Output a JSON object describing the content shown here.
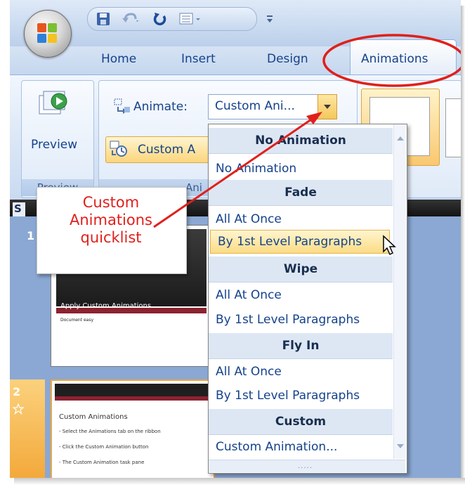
{
  "tabs": [
    {
      "label": "Home"
    },
    {
      "label": "Insert"
    },
    {
      "label": "Design"
    },
    {
      "label": "Animations"
    }
  ],
  "ribbon": {
    "preview_button_label": "Preview",
    "preview_group_label": "Preview",
    "animate_label": "Animate:",
    "animate_value": "Custom Ani...",
    "custom_animation_button_label": "Custom A",
    "animations_group_label_fragment": "Ani"
  },
  "slides_pane": {
    "tab_label": "S",
    "slide1": {
      "number": "1",
      "title": "Apply Custom Animations",
      "subtitle": "Document easy"
    },
    "slide2": {
      "number": "2",
      "title": "Custom Animations",
      "bullets": [
        "- Select the Animations tab on the ribbon",
        "- Click the Custom Animation button",
        "- The Custom Animation task pane"
      ]
    }
  },
  "callout": {
    "line1": "Custom",
    "line2": "Animations",
    "line3": "quicklist"
  },
  "dropdown": {
    "items": [
      {
        "label": "No Animation",
        "kind": "header"
      },
      {
        "label": "No Animation",
        "kind": "item"
      },
      {
        "label": "Fade",
        "kind": "header"
      },
      {
        "label": "All At Once",
        "kind": "item"
      },
      {
        "label": "By 1st Level Paragraphs",
        "kind": "item",
        "selected": true
      },
      {
        "label": "Wipe",
        "kind": "header"
      },
      {
        "label": "All At Once",
        "kind": "item"
      },
      {
        "label": "By 1st Level Paragraphs",
        "kind": "item"
      },
      {
        "label": "Fly In",
        "kind": "header"
      },
      {
        "label": "All At Once",
        "kind": "item"
      },
      {
        "label": "By 1st Level Paragraphs",
        "kind": "item"
      },
      {
        "label": "Custom",
        "kind": "header"
      },
      {
        "label": "Custom Animation...",
        "kind": "item"
      }
    ],
    "grip": "....."
  },
  "icons": [
    "office-button-icon",
    "save-icon",
    "undo-icon",
    "redo-icon",
    "layout-icon",
    "customize-qat-icon",
    "preview-icon",
    "animate-icon",
    "custom-animation-icon",
    "scroll-up-icon",
    "scroll-down-icon",
    "mouse-cursor-icon"
  ],
  "colors": {
    "annotation_red": "#e0201b",
    "ribbon_text": "#15428b",
    "selection": "#fbdc84"
  }
}
